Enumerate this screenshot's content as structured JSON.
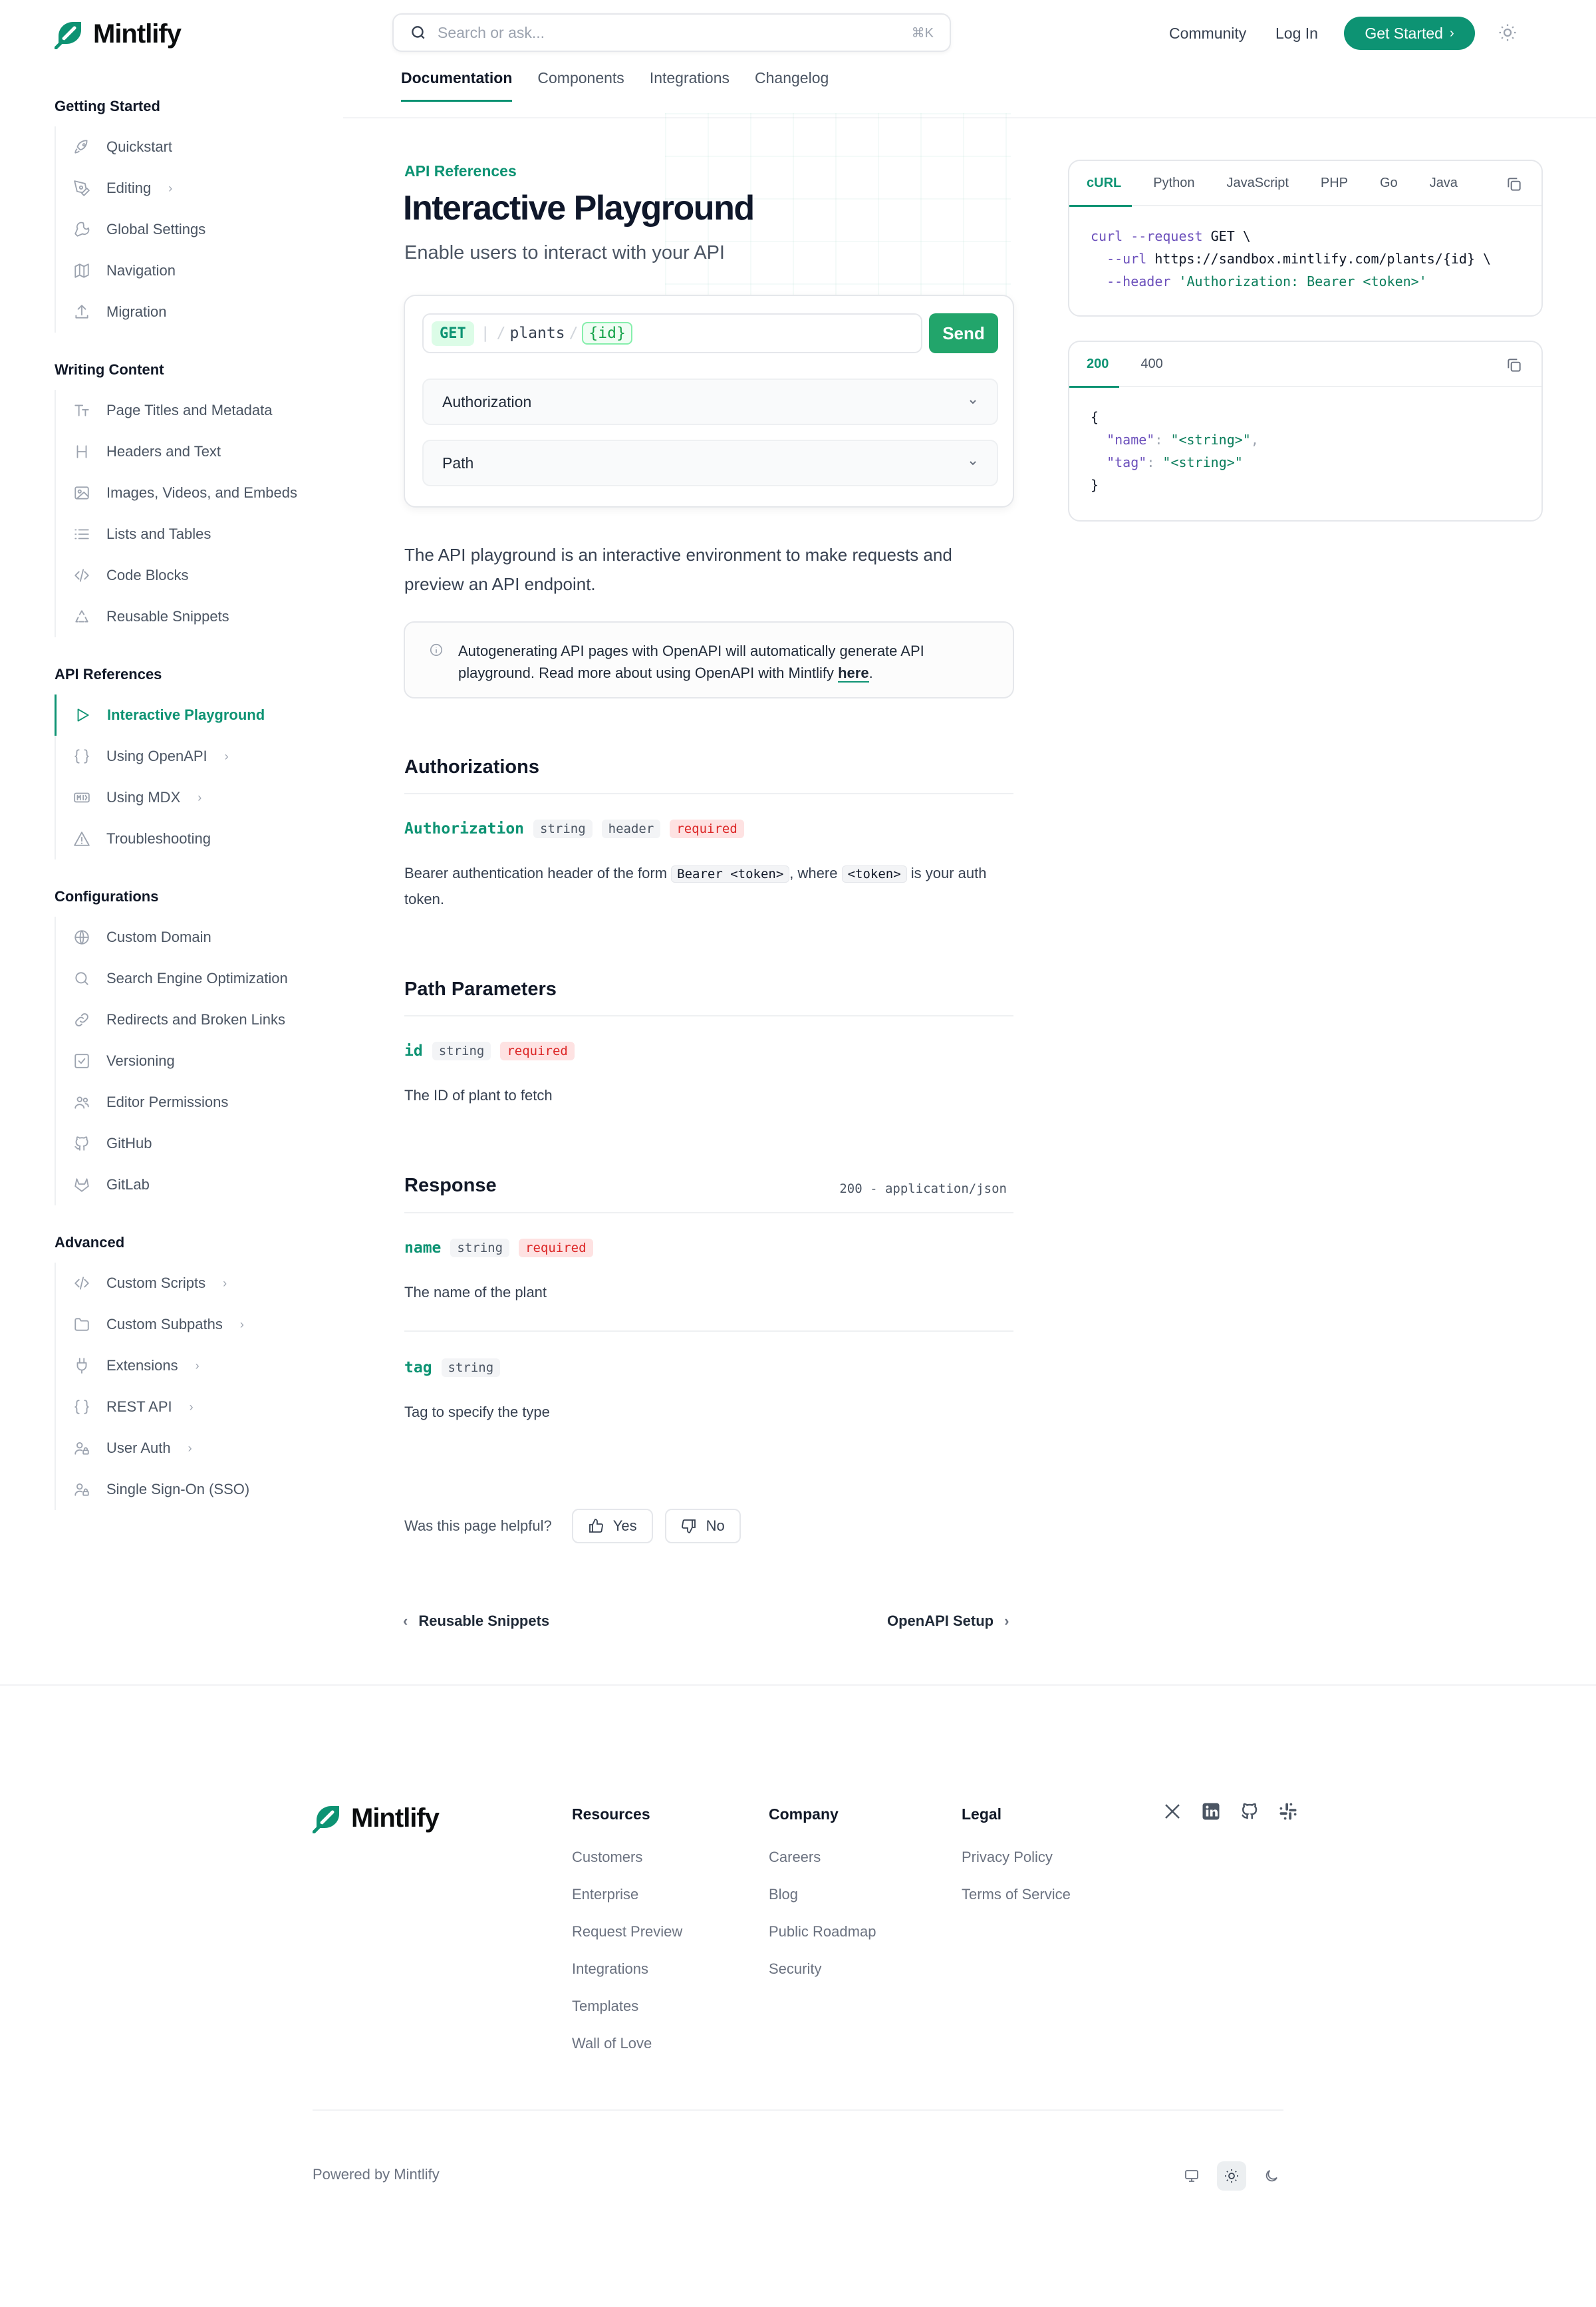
{
  "brand": {
    "name": "Mintlify",
    "accent": "#0d9373"
  },
  "search": {
    "placeholder": "Search or ask...",
    "shortcut": "⌘K"
  },
  "topnav": {
    "community": "Community",
    "login": "Log In",
    "get_started": "Get Started"
  },
  "tabs": [
    "Documentation",
    "Components",
    "Integrations",
    "Changelog"
  ],
  "sidebar": [
    {
      "title": "Getting Started",
      "items": [
        {
          "label": "Quickstart",
          "icon": "rocket-icon",
          "chevron": false
        },
        {
          "label": "Editing",
          "icon": "pen-tool-icon",
          "chevron": true
        },
        {
          "label": "Global Settings",
          "icon": "wrench-icon",
          "chevron": false
        },
        {
          "label": "Navigation",
          "icon": "map-icon",
          "chevron": false
        },
        {
          "label": "Migration",
          "icon": "upload-icon",
          "chevron": false
        }
      ]
    },
    {
      "title": "Writing Content",
      "items": [
        {
          "label": "Page Titles and Metadata",
          "icon": "text-type-icon",
          "chevron": false
        },
        {
          "label": "Headers and Text",
          "icon": "heading-icon",
          "chevron": false
        },
        {
          "label": "Images, Videos, and Embeds",
          "icon": "image-icon",
          "chevron": false
        },
        {
          "label": "Lists and Tables",
          "icon": "list-icon",
          "chevron": false
        },
        {
          "label": "Code Blocks",
          "icon": "code-icon",
          "chevron": false
        },
        {
          "label": "Reusable Snippets",
          "icon": "recycle-icon",
          "chevron": false
        }
      ]
    },
    {
      "title": "API References",
      "items": [
        {
          "label": "Interactive Playground",
          "icon": "play-icon",
          "chevron": false,
          "active": true
        },
        {
          "label": "Using OpenAPI",
          "icon": "braces-icon",
          "chevron": true
        },
        {
          "label": "Using MDX",
          "icon": "mdx-icon",
          "chevron": true
        },
        {
          "label": "Troubleshooting",
          "icon": "warning-icon",
          "chevron": false
        }
      ]
    },
    {
      "title": "Configurations",
      "items": [
        {
          "label": "Custom Domain",
          "icon": "globe-icon",
          "chevron": false
        },
        {
          "label": "Search Engine Optimization",
          "icon": "search-icon",
          "chevron": false
        },
        {
          "label": "Redirects and Broken Links",
          "icon": "link-icon",
          "chevron": false
        },
        {
          "label": "Versioning",
          "icon": "square-check-icon",
          "chevron": false
        },
        {
          "label": "Editor Permissions",
          "icon": "users-icon",
          "chevron": false
        },
        {
          "label": "GitHub",
          "icon": "github-icon",
          "chevron": false
        },
        {
          "label": "GitLab",
          "icon": "gitlab-icon",
          "chevron": false
        }
      ]
    },
    {
      "title": "Advanced",
      "items": [
        {
          "label": "Custom Scripts",
          "icon": "code-icon",
          "chevron": true
        },
        {
          "label": "Custom Subpaths",
          "icon": "folder-icon",
          "chevron": true
        },
        {
          "label": "Extensions",
          "icon": "plug-icon",
          "chevron": true
        },
        {
          "label": "REST API",
          "icon": "braces-icon",
          "chevron": true
        },
        {
          "label": "User Auth",
          "icon": "user-lock-icon",
          "chevron": true
        },
        {
          "label": "Single Sign-On (SSO)",
          "icon": "user-lock-icon",
          "chevron": false
        }
      ]
    }
  ],
  "page": {
    "eyebrow": "API References",
    "title": "Interactive Playground",
    "subtitle": "Enable users to interact with your API",
    "intro": "The API playground is an interactive environment to make requests and preview an API endpoint.",
    "note_before": "Autogenerating API pages with OpenAPI will automatically generate API playground. Read more about using OpenAPI with Mintlify ",
    "note_link": "here",
    "note_after": "."
  },
  "playground": {
    "method": "GET",
    "path_segment": "plants",
    "path_param": "{id}",
    "send": "Send",
    "sections": [
      "Authorization",
      "Path"
    ]
  },
  "authorizations": {
    "heading": "Authorizations",
    "field": "Authorization",
    "type": "string",
    "location": "header",
    "required": "required",
    "desc_1": "Bearer authentication header of the form ",
    "code_1": "Bearer <token>",
    "desc_2": ", where ",
    "code_2": "<token>",
    "desc_3": " is your auth token."
  },
  "path_params": {
    "heading": "Path Parameters",
    "field": "id",
    "type": "string",
    "required": "required",
    "desc": "The ID of plant to fetch"
  },
  "response": {
    "heading": "Response",
    "meta": "200 - application/json",
    "fields": [
      {
        "name": "name",
        "type": "string",
        "required": "required",
        "desc": "The name of the plant"
      },
      {
        "name": "tag",
        "type": "string",
        "required": "",
        "desc": "Tag to specify the type"
      }
    ]
  },
  "feedback": {
    "question": "Was this page helpful?",
    "yes": "Yes",
    "no": "No"
  },
  "pager": {
    "prev": "Reusable Snippets",
    "next": "OpenAPI Setup"
  },
  "request_panel": {
    "tabs": [
      "cURL",
      "Python",
      "JavaScript",
      "PHP",
      "Go",
      "Java"
    ],
    "line1_cmd": "curl",
    "line1_flag": "--request",
    "line1_val": "GET \\",
    "line2_flag": "--url",
    "line2_val": "https://sandbox.mintlify.com/plants/{id} \\",
    "line3_flag": "--header",
    "line3_val": "'Authorization: Bearer <token>'"
  },
  "response_panel": {
    "tabs": [
      "200",
      "400"
    ],
    "open": "{",
    "k1": "\"name\"",
    "v1": "\"<string>\"",
    "k2": "\"tag\"",
    "v2": "\"<string>\"",
    "close": "}"
  },
  "footer": {
    "resources": {
      "title": "Resources",
      "links": [
        "Customers",
        "Enterprise",
        "Request Preview",
        "Integrations",
        "Templates",
        "Wall of Love"
      ]
    },
    "company": {
      "title": "Company",
      "links": [
        "Careers",
        "Blog",
        "Public Roadmap",
        "Security"
      ]
    },
    "legal": {
      "title": "Legal",
      "links": [
        "Privacy Policy",
        "Terms of Service"
      ]
    },
    "social": [
      "x-icon",
      "linkedin-icon",
      "github-icon",
      "slack-icon"
    ],
    "powered": "Powered by Mintlify"
  }
}
